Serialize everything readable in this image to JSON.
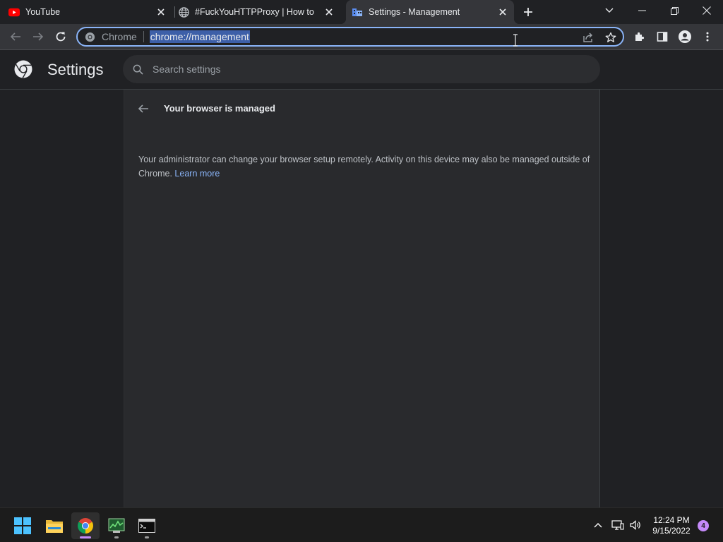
{
  "tabs": [
    {
      "title": "YouTube",
      "favicon": "youtube-icon",
      "active": false
    },
    {
      "title": "#FuckYouHTTPProxy | How to use",
      "favicon": "globe-icon",
      "active": false
    },
    {
      "title": "Settings - Management",
      "favicon": "management-icon",
      "active": true
    }
  ],
  "omnibox": {
    "chip_label": "Chrome",
    "url": "chrome://management"
  },
  "settings": {
    "title": "Settings",
    "search_placeholder": "Search settings"
  },
  "management": {
    "heading": "Your browser is managed",
    "description": "Your administrator can change your browser setup remotely. Activity on this device may also be managed outside of Chrome.",
    "learn_more": "Learn more"
  },
  "taskbar": {
    "time": "12:24 PM",
    "date": "9/15/2022",
    "notification_count": "4"
  },
  "colors": {
    "accent": "#8ab4f8",
    "background": "#202124",
    "card": "#292a2d",
    "taskbar_active_indicator": "#c58af9"
  }
}
